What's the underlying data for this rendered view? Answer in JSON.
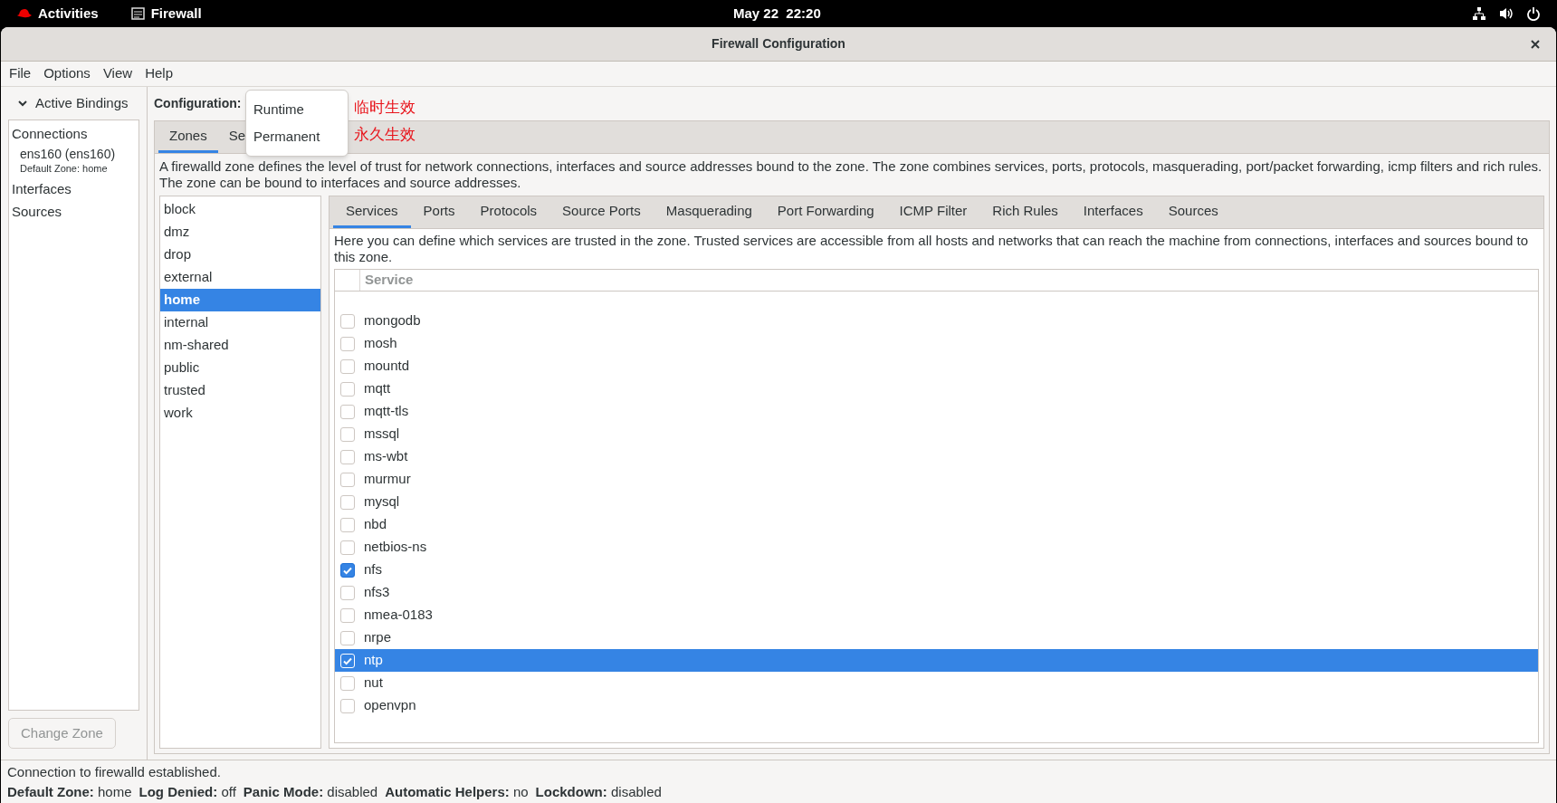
{
  "top_bar": {
    "activities": "Activities",
    "app": "Firewall",
    "clock": "May 22  22:20"
  },
  "window": {
    "title": "Firewall Configuration"
  },
  "menu": [
    "File",
    "Options",
    "View",
    "Help"
  ],
  "active_bindings": {
    "title": "Active Bindings",
    "expanded": true,
    "items": [
      {
        "kind": "heading",
        "label": "Connections"
      },
      {
        "kind": "connection",
        "label": "ens160 (ens160)",
        "detail": "Default Zone: home"
      },
      {
        "kind": "heading",
        "label": "Interfaces"
      },
      {
        "kind": "heading",
        "label": "Sources"
      }
    ],
    "button": {
      "label": "Change Zone",
      "disabled": true
    }
  },
  "configuration": {
    "label": "Configuration:",
    "options": [
      {
        "label": "Runtime",
        "annotation": "临时生效"
      },
      {
        "label": "Permanent",
        "annotation": "永久生效"
      }
    ]
  },
  "outer_tabs": [
    {
      "label": "Zones",
      "selected": true
    },
    {
      "label": "Se",
      "selected": false
    }
  ],
  "zone_description": "A firewalld zone defines the level of trust for network connections, interfaces and source addresses bound to the zone. The zone combines services, ports, protocols, masquerading, port/packet forwarding, icmp filters and rich rules. The zone can be bound to interfaces and source addresses.",
  "zones": [
    {
      "label": "block",
      "selected": false
    },
    {
      "label": "dmz",
      "selected": false
    },
    {
      "label": "drop",
      "selected": false
    },
    {
      "label": "external",
      "selected": false
    },
    {
      "label": "home",
      "selected": true
    },
    {
      "label": "internal",
      "selected": false
    },
    {
      "label": "nm-shared",
      "selected": false
    },
    {
      "label": "public",
      "selected": false
    },
    {
      "label": "trusted",
      "selected": false
    },
    {
      "label": "work",
      "selected": false
    }
  ],
  "zone_tabs": [
    {
      "label": "Services",
      "selected": true
    },
    {
      "label": "Ports",
      "selected": false
    },
    {
      "label": "Protocols",
      "selected": false
    },
    {
      "label": "Source Ports",
      "selected": false
    },
    {
      "label": "Masquerading",
      "selected": false
    },
    {
      "label": "Port Forwarding",
      "selected": false
    },
    {
      "label": "ICMP Filter",
      "selected": false
    },
    {
      "label": "Rich Rules",
      "selected": false
    },
    {
      "label": "Interfaces",
      "selected": false
    },
    {
      "label": "Sources",
      "selected": false
    }
  ],
  "services_description": "Here you can define which services are trusted in the zone. Trusted services are accessible from all hosts and networks that can reach the machine from connections, interfaces and sources bound to this zone.",
  "services": {
    "column": "Service",
    "rows": [
      {
        "name": "mongodb",
        "checked": false,
        "selected": false
      },
      {
        "name": "mosh",
        "checked": false,
        "selected": false
      },
      {
        "name": "mountd",
        "checked": false,
        "selected": false
      },
      {
        "name": "mqtt",
        "checked": false,
        "selected": false
      },
      {
        "name": "mqtt-tls",
        "checked": false,
        "selected": false
      },
      {
        "name": "mssql",
        "checked": false,
        "selected": false
      },
      {
        "name": "ms-wbt",
        "checked": false,
        "selected": false
      },
      {
        "name": "murmur",
        "checked": false,
        "selected": false
      },
      {
        "name": "mysql",
        "checked": false,
        "selected": false
      },
      {
        "name": "nbd",
        "checked": false,
        "selected": false
      },
      {
        "name": "netbios-ns",
        "checked": false,
        "selected": false
      },
      {
        "name": "nfs",
        "checked": true,
        "selected": false
      },
      {
        "name": "nfs3",
        "checked": false,
        "selected": false
      },
      {
        "name": "nmea-0183",
        "checked": false,
        "selected": false
      },
      {
        "name": "nrpe",
        "checked": false,
        "selected": false
      },
      {
        "name": "ntp",
        "checked": true,
        "selected": true
      },
      {
        "name": "nut",
        "checked": false,
        "selected": false
      },
      {
        "name": "openvpn",
        "checked": false,
        "selected": false
      }
    ]
  },
  "status": {
    "message": "Connection to firewalld established.",
    "fields": [
      {
        "label": "Default Zone:",
        "value": "home"
      },
      {
        "label": "Log Denied:",
        "value": "off"
      },
      {
        "label": "Panic Mode:",
        "value": "disabled"
      },
      {
        "label": "Automatic Helpers:",
        "value": "no"
      },
      {
        "label": "Lockdown:",
        "value": "disabled"
      }
    ]
  }
}
